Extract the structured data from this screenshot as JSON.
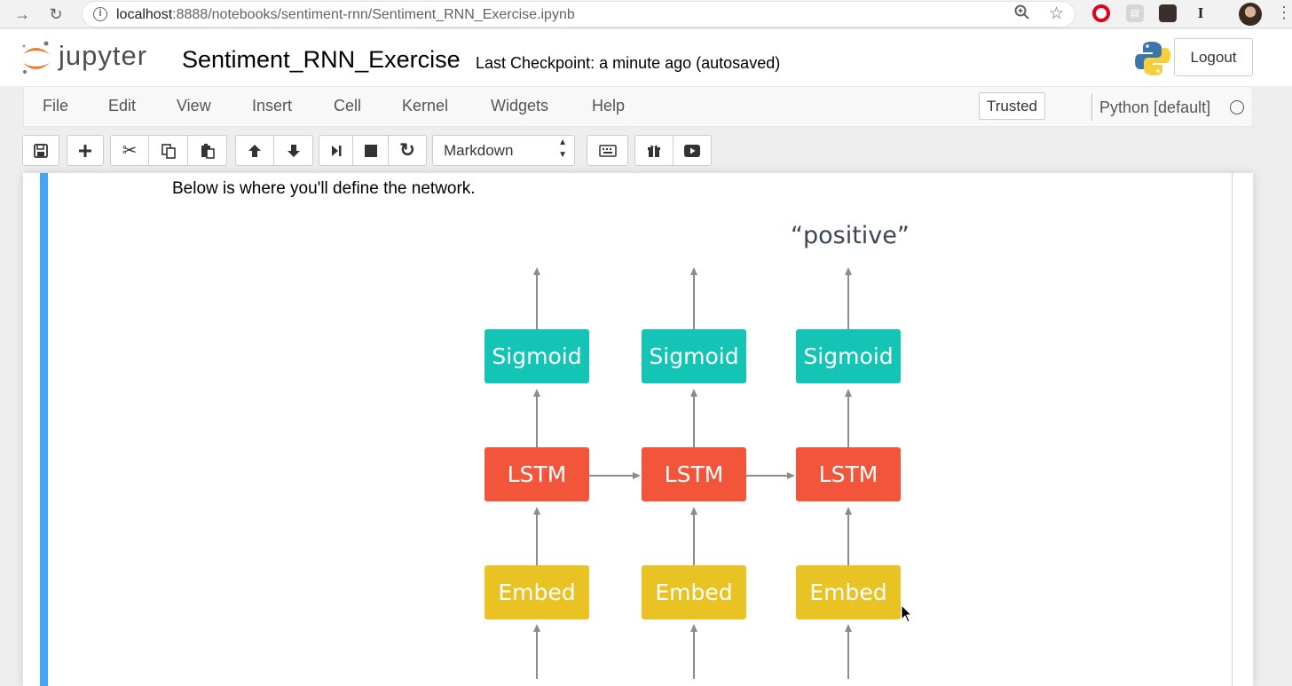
{
  "browser": {
    "back_icon": "arrow-right-icon",
    "reload_icon": "reload-icon",
    "url_host": "localhost",
    "url_rest": ":8888/notebooks/sentiment-rnn/Sentiment_RNN_Exercise.ipynb"
  },
  "header": {
    "logo_text": "jupyter",
    "notebook_name": "Sentiment_RNN_Exercise",
    "checkpoint": "Last Checkpoint: a minute ago (autosaved)",
    "logout_label": "Logout"
  },
  "menubar": {
    "items": [
      "File",
      "Edit",
      "View",
      "Insert",
      "Cell",
      "Kernel",
      "Widgets",
      "Help"
    ],
    "trusted_label": "Trusted",
    "kernel_name": "Python [default]"
  },
  "toolbar": {
    "cell_type": "Markdown"
  },
  "cell": {
    "text": "Below is where you'll define the network."
  },
  "diagram": {
    "output_label": "“positive”",
    "columns": [
      {
        "top": "Sigmoid",
        "middle": "LSTM",
        "bottom": "Embed"
      },
      {
        "top": "Sigmoid",
        "middle": "LSTM",
        "bottom": "Embed"
      },
      {
        "top": "Sigmoid",
        "middle": "LSTM",
        "bottom": "Embed"
      }
    ],
    "colors": {
      "sigmoid": "#14c5b6",
      "lstm": "#f2553a",
      "embed": "#e8c323",
      "arrow": "#8c8c8c"
    }
  }
}
